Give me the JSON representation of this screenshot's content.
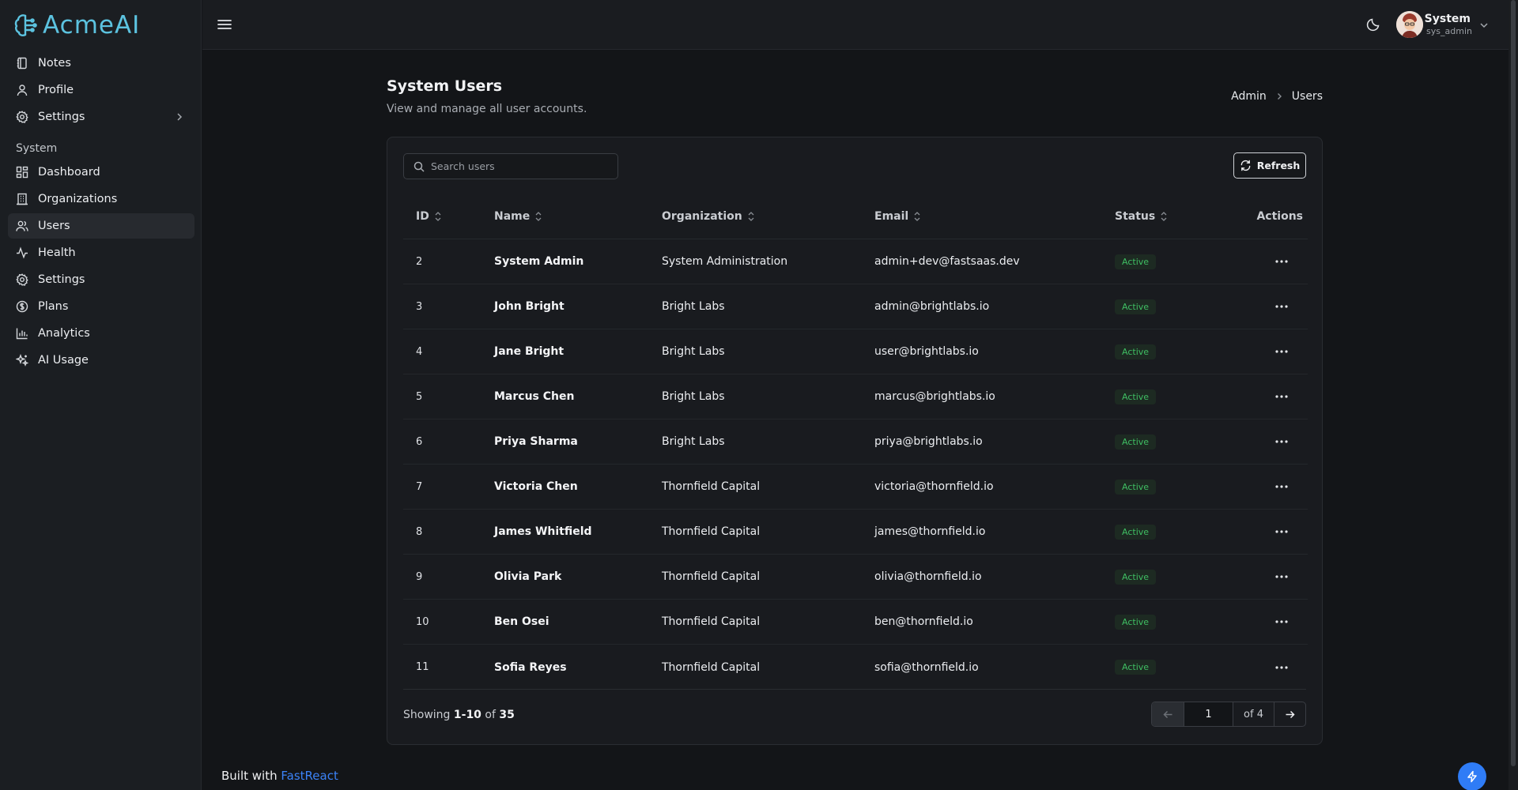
{
  "app": {
    "name": "AcmeAI"
  },
  "sidebar": {
    "items": [
      {
        "label": "Notes",
        "icon": "notebook-icon"
      },
      {
        "label": "Profile",
        "icon": "user-icon"
      },
      {
        "label": "Settings",
        "icon": "gear-icon",
        "has_submenu": true
      }
    ],
    "section_label": "System",
    "system_items": [
      {
        "label": "Dashboard",
        "icon": "dashboard-icon"
      },
      {
        "label": "Organizations",
        "icon": "building-icon"
      },
      {
        "label": "Users",
        "icon": "users-icon",
        "active": true
      },
      {
        "label": "Health",
        "icon": "activity-icon"
      },
      {
        "label": "Settings",
        "icon": "gear-icon"
      },
      {
        "label": "Plans",
        "icon": "dollar-circle-icon"
      },
      {
        "label": "Analytics",
        "icon": "bar-chart-icon"
      },
      {
        "label": "AI Usage",
        "icon": "sparkles-icon"
      }
    ]
  },
  "header": {
    "user_name": "System",
    "user_role": "sys_admin"
  },
  "page": {
    "title": "System Users",
    "subtitle": "View and manage all user accounts.",
    "breadcrumb": [
      "Admin",
      "Users"
    ]
  },
  "toolbar": {
    "search_placeholder": "Search users",
    "refresh_label": "Refresh"
  },
  "table": {
    "columns": [
      "ID",
      "Name",
      "Organization",
      "Email",
      "Status",
      "Actions"
    ],
    "rows": [
      {
        "id": "2",
        "name": "System Admin",
        "org": "System Administration",
        "email": "admin+dev@fastsaas.dev",
        "status": "Active"
      },
      {
        "id": "3",
        "name": "John Bright",
        "org": "Bright Labs",
        "email": "admin@brightlabs.io",
        "status": "Active"
      },
      {
        "id": "4",
        "name": "Jane Bright",
        "org": "Bright Labs",
        "email": "user@brightlabs.io",
        "status": "Active"
      },
      {
        "id": "5",
        "name": "Marcus Chen",
        "org": "Bright Labs",
        "email": "marcus@brightlabs.io",
        "status": "Active"
      },
      {
        "id": "6",
        "name": "Priya Sharma",
        "org": "Bright Labs",
        "email": "priya@brightlabs.io",
        "status": "Active"
      },
      {
        "id": "7",
        "name": "Victoria Chen",
        "org": "Thornfield Capital",
        "email": "victoria@thornfield.io",
        "status": "Active"
      },
      {
        "id": "8",
        "name": "James Whitfield",
        "org": "Thornfield Capital",
        "email": "james@thornfield.io",
        "status": "Active"
      },
      {
        "id": "9",
        "name": "Olivia Park",
        "org": "Thornfield Capital",
        "email": "olivia@thornfield.io",
        "status": "Active"
      },
      {
        "id": "10",
        "name": "Ben Osei",
        "org": "Thornfield Capital",
        "email": "ben@thornfield.io",
        "status": "Active"
      },
      {
        "id": "11",
        "name": "Sofia Reyes",
        "org": "Thornfield Capital",
        "email": "sofia@thornfield.io",
        "status": "Active"
      }
    ]
  },
  "pagination": {
    "showing_prefix": "Showing",
    "range": "1-10",
    "of_word": "of",
    "total": "35",
    "current_page": "1",
    "of_pages": "of 4"
  },
  "footer": {
    "built_with": "Built with",
    "brand": "FastReact"
  },
  "colors": {
    "accent": "#3b82f6",
    "status_active": "#3fbf63",
    "logo": "#5cc3e0"
  }
}
